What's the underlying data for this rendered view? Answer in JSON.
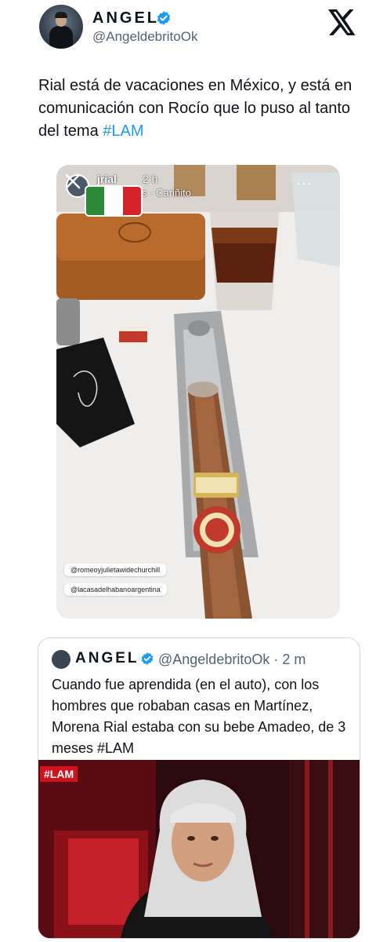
{
  "tweet": {
    "display_name": "ANGEL",
    "handle": "@AngeldebritoOk",
    "text_main": "Rial está de vacaciones en México, y está en comunicación con Rocío que lo puso al tanto del tema ",
    "hashtag": "#LAM",
    "icons": {
      "avatar": "user-avatar",
      "verified": "verified-badge-icon",
      "platform": "x-logo-icon"
    },
    "colors": {
      "text": "#0f1419",
      "secondary": "#536471",
      "link": "#1d9bf0",
      "verified": "#1d9bf0"
    }
  },
  "story": {
    "username": "jrial",
    "time": "2 h",
    "music": "Lila Downs · Cariñito",
    "more_icon": "more-options-icon",
    "close_icon": "close-icon",
    "flag_colors": [
      "#2a8a3a",
      "#ffffff",
      "#d6232a"
    ],
    "sticker_1": "@romeoyjulietawidechurchill",
    "sticker_2": "@lacasadelhabanoargentina"
  },
  "quote": {
    "display_name": "ANGEL",
    "handle": "@AngeldebritoOk",
    "time": "2 m",
    "text": "Cuando fue aprendida (en el auto), con los hombres que robaban casas en Martínez, Morena Rial estaba con su bebe Amadeo, de 3 meses  #LAM",
    "badge": "#LAM"
  }
}
